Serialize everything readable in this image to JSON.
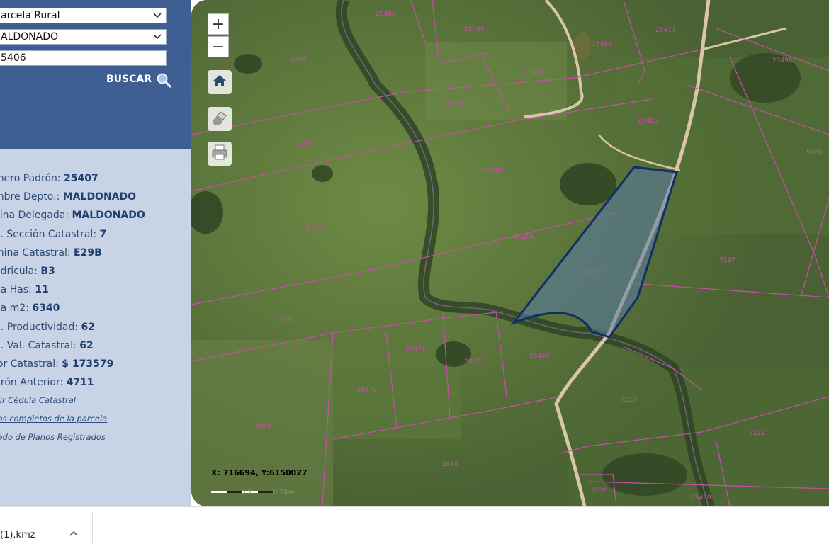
{
  "search": {
    "type_value": "arcela Rural",
    "department_value": "ALDONADO",
    "padron_value": "5406",
    "buscar_label": "BUSCAR"
  },
  "info": {
    "rows": [
      {
        "label": "mero Padrón:",
        "value": "25407"
      },
      {
        "label": "mbre Depto.:",
        "value": "MALDONADO"
      },
      {
        "label": "cina Delegada:",
        "value": "MALDONADO"
      },
      {
        "label": "o. Sección Catastral:",
        "value": "7"
      },
      {
        "label": "mina Catastral:",
        "value": "E29B"
      },
      {
        "label": "ádricula:",
        "value": "B3"
      },
      {
        "label": "ea Has:",
        "value": "11"
      },
      {
        "label": "ea m2:",
        "value": "6340"
      },
      {
        "label": "d. Productividad:",
        "value": "62"
      },
      {
        "label": "d. Val. Catastral:",
        "value": "62"
      },
      {
        "label": "lor Catastral:",
        "value": "$ 173579"
      },
      {
        "label": "drón Anterior:",
        "value": "4711"
      }
    ],
    "links": [
      "itir Cédula Catastral",
      "tos completos de la parcela",
      "tado de Planos Registrados"
    ]
  },
  "map": {
    "zoom_in": "+",
    "zoom_out": "−",
    "coords": "X: 716694, Y:6150027",
    "scale_labels": [
      "0.1",
      "0.2km"
    ],
    "parcel_labels": [
      "25489",
      "25490",
      "25473",
      "25491",
      "25484",
      "2409",
      "25490",
      "25406",
      "2548",
      "25485",
      "25480",
      "25409",
      "25407",
      "5194",
      "5195",
      "7197",
      "25472",
      "25420",
      "20471",
      "20471",
      "5966",
      "7220",
      "2221",
      "2016",
      "5066",
      "2020",
      "25490",
      "25494"
    ],
    "colors": {
      "parcel_line": "#c64fa8",
      "selection_stroke": "#0f2f66",
      "selection_fill": "#5a7aa8",
      "road": "#d9c6a8"
    }
  },
  "downloads": {
    "file_name": "(1).kmz",
    "chevron": "^"
  }
}
